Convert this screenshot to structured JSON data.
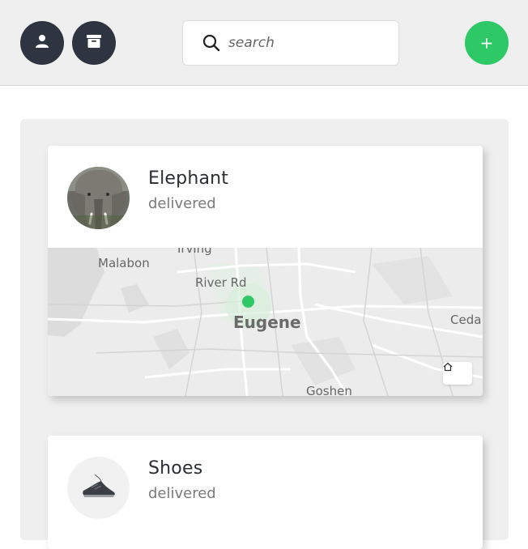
{
  "header": {
    "user_button": {
      "icon": "user-icon"
    },
    "archive_button": {
      "icon": "archive-icon"
    },
    "search": {
      "placeholder": "search",
      "icon": "search-icon"
    },
    "add_button": {
      "label": "+"
    }
  },
  "colors": {
    "accent": "#2ec866",
    "dark_button": "#2e3540",
    "background": "#efefef"
  },
  "items": [
    {
      "title": "Elephant",
      "status": "delivered",
      "avatar": "elephant-photo",
      "map": {
        "labels": [
          "Irving",
          "Malabon",
          "River Rd",
          "Eugene",
          "Ceda",
          "Goshen"
        ],
        "home_button": {
          "icon": "home-icon"
        }
      }
    },
    {
      "title": "Shoes",
      "status": "delivered",
      "avatar": "shoe-photo"
    }
  ]
}
